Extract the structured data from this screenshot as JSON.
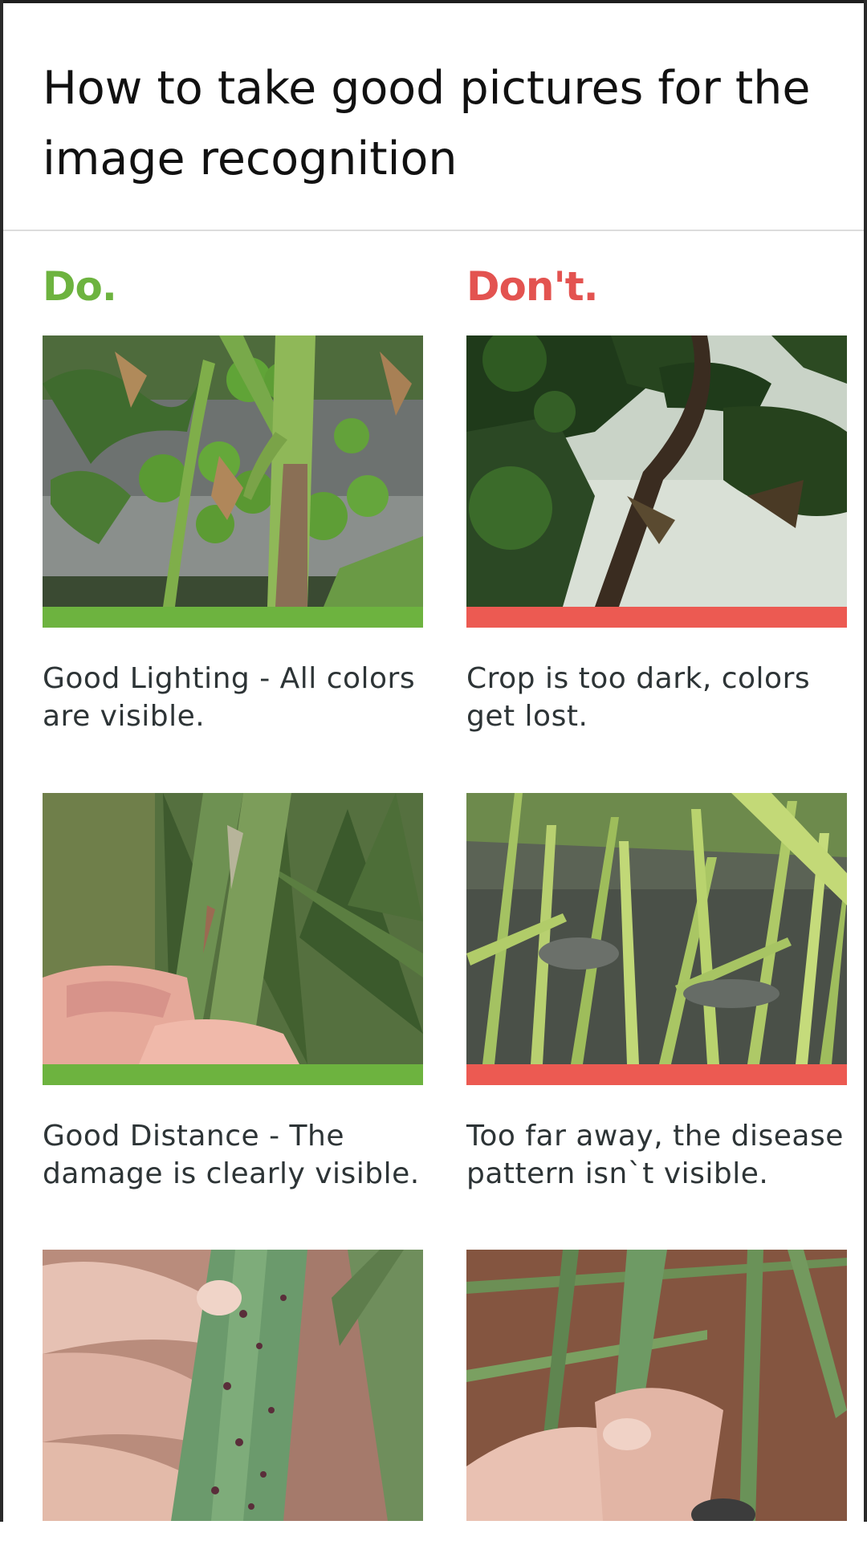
{
  "header": {
    "title": "How to take good pictures for the image recognition"
  },
  "columns": {
    "do_label": "Do.",
    "dont_label": "Don't.",
    "do_color": "#6db33f",
    "dont_color": "#e35350"
  },
  "examples": [
    {
      "kind": "do",
      "caption": "Good Lighting - All colors are visible.",
      "image": "tomato-plant-photo"
    },
    {
      "kind": "dont",
      "caption": "Crop is too dark, colors get lost.",
      "image": "dark-tomato-plant-photo"
    },
    {
      "kind": "do",
      "caption": "Good Distance - The damage is clearly visible.",
      "image": "close-up-leaf-in-hand-photo"
    },
    {
      "kind": "dont",
      "caption": "Too far away, the disease pattern isn`t visible.",
      "image": "distant-rice-field-photo"
    },
    {
      "kind": "do",
      "caption": "",
      "image": "spotted-leaf-in-hand-photo"
    },
    {
      "kind": "dont",
      "caption": "",
      "image": "leaf-in-hand-field-photo"
    }
  ]
}
